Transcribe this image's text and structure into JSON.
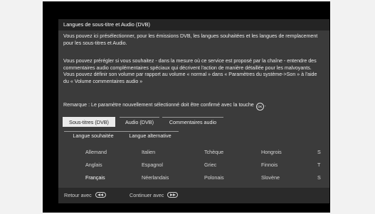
{
  "dialog": {
    "title": "Langues de sous-titre et Audio (DVB)",
    "paragraph1": "Vous pouvez ici présélectionner, pour les émissions DVB, les langues souhaitées et les langues de remplacement pour les sous-titres et Audio.",
    "paragraph2": "Vous pouvez prérégler si vous souhaitez - dans la mesure où ce service est proposé par la chaîne - entendre des commentaires audio complémentaires spéciaux qui décrivent l'action de manière détaillée pour les malvoyants. Vous pouvez définir son volume par rapport au volume « normal » dans « Paramètres du système->Son » à l'aide du « Volume commentaires audio »",
    "remark_before": "Remarque : Le paramètre nouvellement sélectionné doit être confirmé avec la touche",
    "remark_key": "OK",
    "remark_after": "."
  },
  "tabs": [
    {
      "label": "Sous-titres (DVB)",
      "active": true
    },
    {
      "label": "Audio (DVB)",
      "active": false
    },
    {
      "label": "Commentaires audio",
      "active": false
    }
  ],
  "subtabs": [
    {
      "label": "Langue souhaitée",
      "active": true
    },
    {
      "label": "Langue alternative",
      "active": false
    }
  ],
  "languages": {
    "row1": [
      "Allemand",
      "Italien",
      "Tchèque",
      "Hongrois",
      "S"
    ],
    "row2": [
      "Anglais",
      "Espagnol",
      "Griec",
      "Finnois",
      "T"
    ],
    "row3": [
      "Français",
      "Néerlandais",
      "Polonais",
      "Slovène",
      "S"
    ],
    "selected": "Français"
  },
  "footer": {
    "back_label": "Retour avec",
    "continue_label": "Continuer avec",
    "back_icon": "rewind-key-icon",
    "continue_icon": "fast-forward-key-icon"
  }
}
